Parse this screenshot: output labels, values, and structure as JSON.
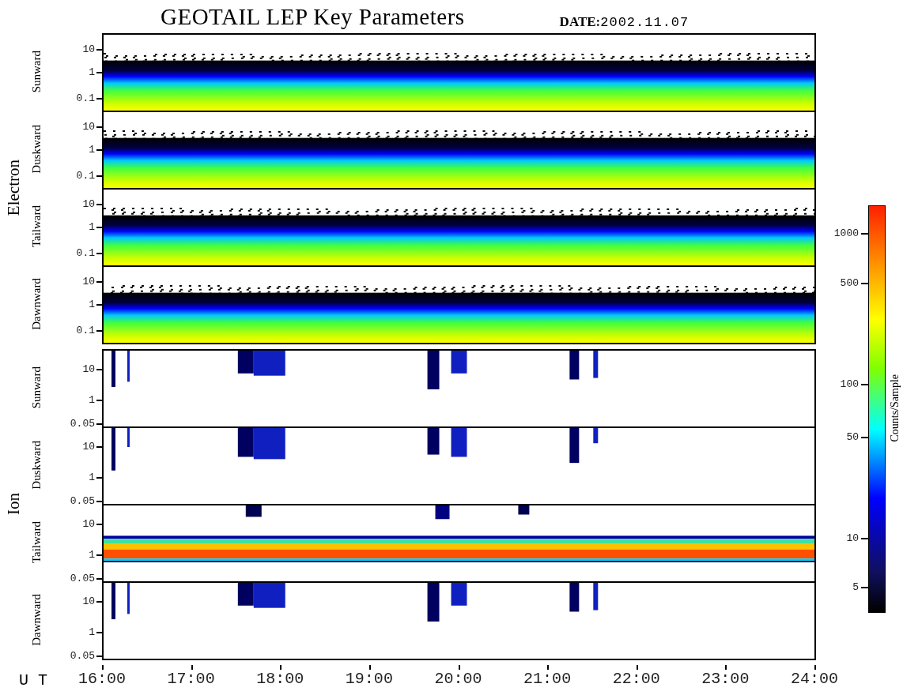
{
  "title": "GEOTAIL LEP Key Parameters",
  "date_label": "DATE:",
  "date": "2002.11.07",
  "groups": [
    {
      "label": "Electron",
      "panels": [
        {
          "label": "Sunward",
          "kind": "electron",
          "yticks": [
            "10",
            "1",
            "0.1"
          ]
        },
        {
          "label": "Duskward",
          "kind": "electron",
          "yticks": [
            "10",
            "1",
            "0.1"
          ]
        },
        {
          "label": "Tailward",
          "kind": "electron",
          "yticks": [
            "10",
            "1",
            "0.1"
          ]
        },
        {
          "label": "Dawnward",
          "kind": "electron",
          "yticks": [
            "10",
            "1",
            "0.1"
          ]
        }
      ]
    },
    {
      "label": "Ion",
      "panels": [
        {
          "label": "Sunward",
          "kind": "sparse",
          "yticks": [
            "10",
            "1",
            "0.05"
          ]
        },
        {
          "label": "Duskward",
          "kind": "sparse",
          "yticks": [
            "10",
            "1",
            "0.05"
          ]
        },
        {
          "label": "Tailward",
          "kind": "band",
          "yticks": [
            "10",
            "1",
            "0.05"
          ]
        },
        {
          "label": "Dawnward",
          "kind": "sparse",
          "yticks": [
            "10",
            "1",
            "0.05"
          ]
        }
      ]
    }
  ],
  "colorbar": {
    "label": "Counts/Sample",
    "ticks": [
      "1000",
      "500",
      "100",
      "50",
      "10",
      "5"
    ]
  },
  "xaxis": {
    "label": "U T",
    "ticks": [
      "16:00",
      "17:00",
      "18:00",
      "19:00",
      "20:00",
      "21:00",
      "22:00",
      "23:00",
      "24:00"
    ]
  }
}
